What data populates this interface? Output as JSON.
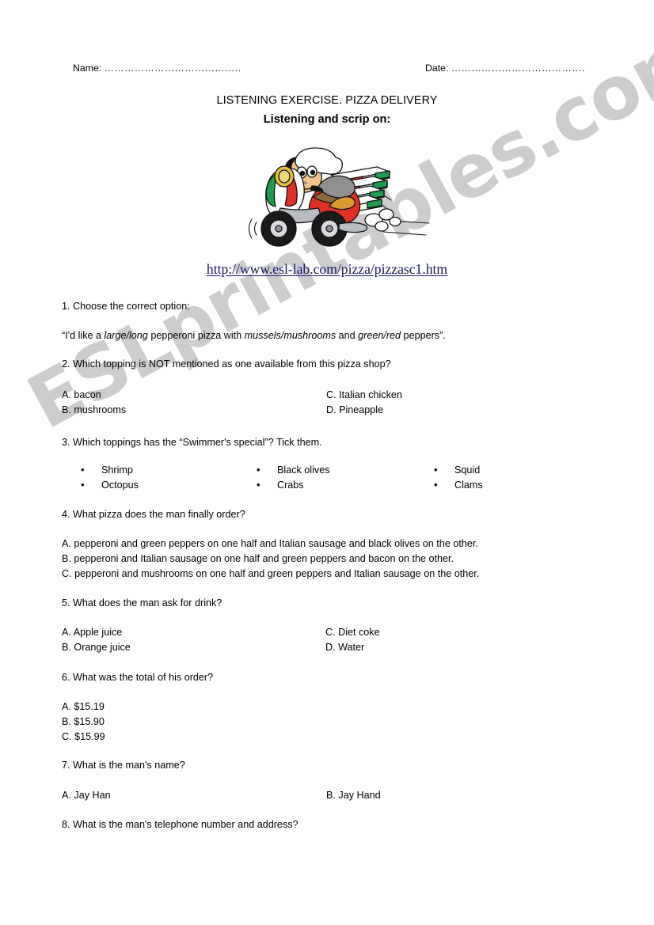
{
  "header": {
    "name_label": "Name:",
    "name_dots": "…………………………………..",
    "date_label": "Date:",
    "date_dots": "…………………………………."
  },
  "title": {
    "line1": "LISTENING EXERCISE. PIZZA DELIVERY",
    "line2": "Listening and scrip on:"
  },
  "illustration": {
    "alt": "cartoon pizza delivery chef riding a red scooter carrying a stack of pizza boxes",
    "colors": {
      "scooter_body": "#e03127",
      "flag_green": "#1f9b4e",
      "flag_red": "#e03127",
      "skin": "#f2c48a",
      "hat": "#ffffff",
      "tire": "#1a1a1a",
      "metal": "#b9bcc0"
    }
  },
  "link": {
    "url_text": "http://www.esl-lab.com/pizza/pizzasc1.htm",
    "color": "#17166e"
  },
  "watermark": {
    "text": "ESLprintables.com",
    "color": "#cdcdcd"
  },
  "questions": {
    "q1": {
      "prompt": "1. Choose the correct option:",
      "sentence_parts": {
        "p1": "“I'd like a ",
        "i1": "large/long",
        "p2": " pepperoni pizza with ",
        "i2": "mussels/mushrooms",
        "p3": " and ",
        "i3": "green/red",
        "p4": " peppers”."
      }
    },
    "q2": {
      "prompt": "2.  Which topping is NOT mentioned as one available from this pizza shop?",
      "options": [
        {
          "key": "A",
          "text": "A. bacon"
        },
        {
          "key": "B",
          "text": "B. mushrooms"
        },
        {
          "key": "C",
          "text": "C. Italian chicken"
        },
        {
          "key": "D",
          "text": "D. Pineapple"
        }
      ]
    },
    "q3": {
      "prompt": "3. Which toppings has the “Swimmer's special”? Tick them.",
      "items": [
        "Shrimp",
        "Octopus",
        "Black olives",
        "Crabs",
        "Squid",
        "Clams"
      ]
    },
    "q4": {
      "prompt": "4. What pizza does the man finally order?",
      "options": [
        "A. pepperoni and green peppers on one half and Italian sausage and black olives on the other.",
        "B. pepperoni and Italian sausage on one half and green peppers and bacon on the other.",
        "C. pepperoni and mushrooms on one half and green peppers and Italian sausage on the other."
      ]
    },
    "q5": {
      "prompt": "5.  What does the man ask for drink?",
      "options": [
        {
          "key": "A",
          "text": "A. Apple juice"
        },
        {
          "key": "B",
          "text": "B. Orange juice"
        },
        {
          "key": "C",
          "text": "C. Diet coke"
        },
        {
          "key": "D",
          "text": "D. Water"
        }
      ]
    },
    "q6": {
      "prompt": "6.  What was the total of his order?",
      "options": [
        "A. $15.19",
        "B. $15.90",
        "C. $15.99"
      ]
    },
    "q7": {
      "prompt": "7.  What is the man's name?",
      "options": [
        {
          "key": "A",
          "text": "A. Jay Han"
        },
        {
          "key": "B",
          "text": "B. Jay Hand"
        }
      ]
    },
    "q8": {
      "prompt": "8.  What is the man's telephone number and address?"
    }
  }
}
